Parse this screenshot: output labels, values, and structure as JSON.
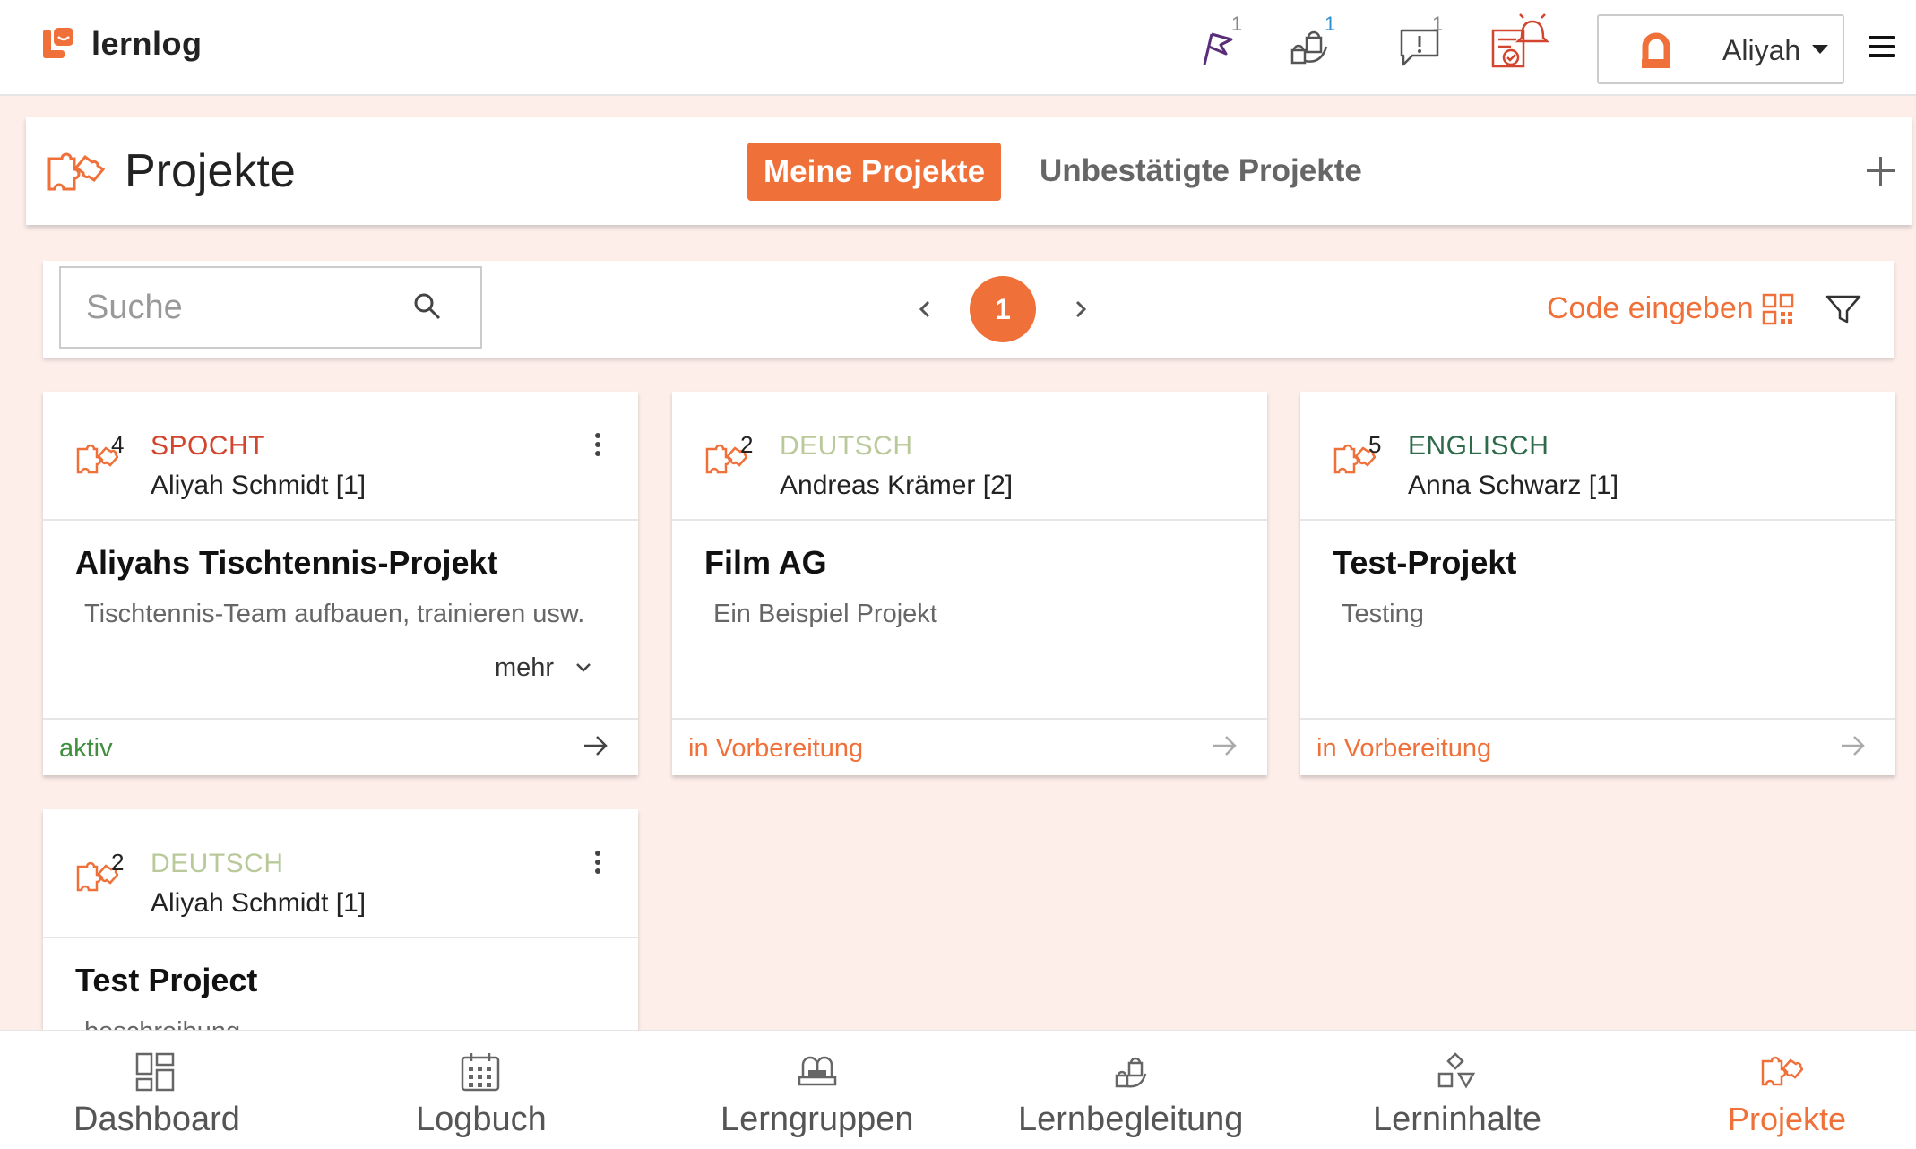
{
  "app": {
    "name": "lernlog"
  },
  "topbar": {
    "badges": {
      "flag": "1",
      "mentor": "1",
      "messages": "1"
    },
    "user": {
      "name": "Aliyah"
    }
  },
  "header": {
    "title": "Projekte",
    "tabs": {
      "active": "Meine Projekte",
      "inactive": "Unbestätigte Projekte"
    }
  },
  "toolbar": {
    "search_placeholder": "Suche",
    "page_current": "1",
    "code_label": "Code eingeben"
  },
  "projects": [
    {
      "count": "4",
      "subject": "SPOCHT",
      "subject_color": "#d2452e",
      "owner": "Aliyah Schmidt [1]",
      "title": "Aliyahs Tischtennis-Projekt",
      "description": "Tischtennis-Team aufbauen, trainieren usw.",
      "more": "mehr",
      "status": "aktiv",
      "status_color": "#3f8f3f"
    },
    {
      "count": "2",
      "subject": "DEUTSCH",
      "subject_color": "#b9c99a",
      "owner": "Andreas Krämer [2]",
      "title": "Film AG",
      "description": "Ein Beispiel Projekt",
      "status": "in Vorbereitung",
      "status_color": "#f0703a"
    },
    {
      "count": "5",
      "subject": "ENGLISCH",
      "subject_color": "#2f6b4a",
      "owner": "Anna Schwarz [1]",
      "title": "Test-Projekt",
      "description": "Testing",
      "status": "in Vorbereitung",
      "status_color": "#f0703a"
    },
    {
      "count": "2",
      "subject": "DEUTSCH",
      "subject_color": "#b9c99a",
      "owner": "Aliyah Schmidt [1]",
      "title": "Test Project",
      "description": "beschreibung"
    }
  ],
  "bottom_nav": [
    {
      "label": "Dashboard",
      "icon": "dashboard-icon"
    },
    {
      "label": "Logbuch",
      "icon": "calendar-icon"
    },
    {
      "label": "Lerngruppen",
      "icon": "group-icon"
    },
    {
      "label": "Lernbegleitung",
      "icon": "mentor-icon"
    },
    {
      "label": "Lerninhalte",
      "icon": "shapes-icon"
    },
    {
      "label": "Projekte",
      "icon": "puzzle-icon",
      "active": true
    }
  ],
  "colors": {
    "accent": "#f0703a",
    "active_green": "#3f8f3f",
    "background": "#fdeeea"
  }
}
